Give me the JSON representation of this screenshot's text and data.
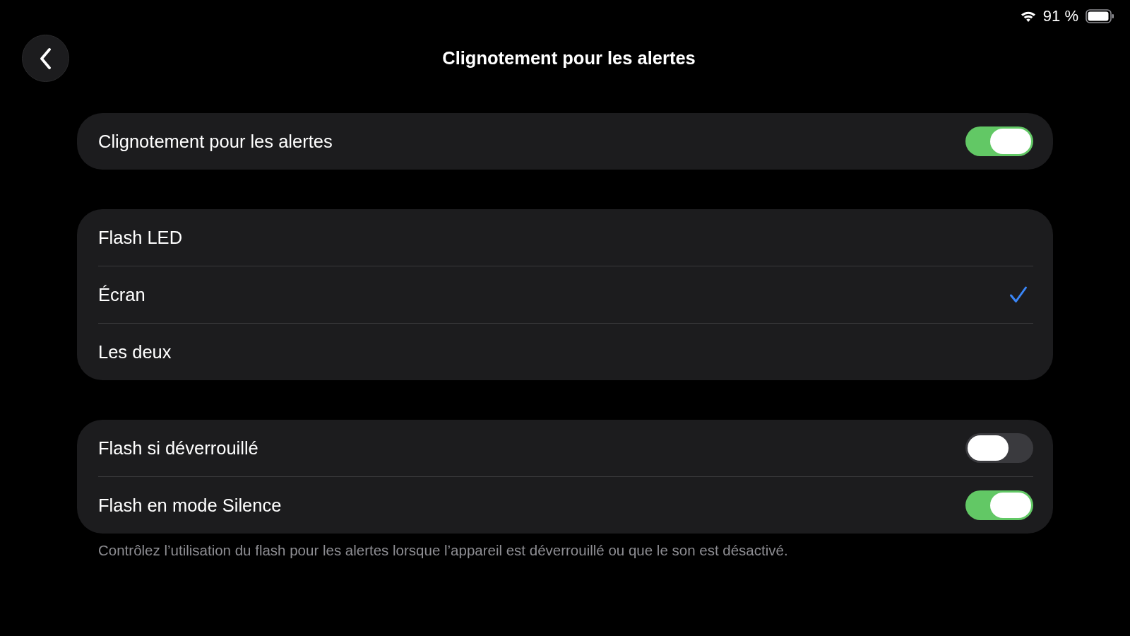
{
  "status_bar": {
    "battery_text": "91 %"
  },
  "nav": {
    "title": "Clignotement pour les alertes"
  },
  "sections": [
    {
      "rows": [
        {
          "kind": "toggle",
          "label": "Clignotement pour les alertes",
          "on": true
        }
      ]
    },
    {
      "rows": [
        {
          "kind": "choice",
          "label": "Flash LED",
          "selected": false
        },
        {
          "kind": "choice",
          "label": "Écran",
          "selected": true
        },
        {
          "kind": "choice",
          "label": "Les deux",
          "selected": false
        }
      ]
    },
    {
      "rows": [
        {
          "kind": "toggle",
          "label": "Flash si déverrouillé",
          "on": false
        },
        {
          "kind": "toggle",
          "label": "Flash en mode Silence",
          "on": true
        }
      ],
      "footer": "Contrôlez l’utilisation du flash pour les alertes lorsque l’appareil est déverrouillé ou que le son est désactivé."
    }
  ]
}
